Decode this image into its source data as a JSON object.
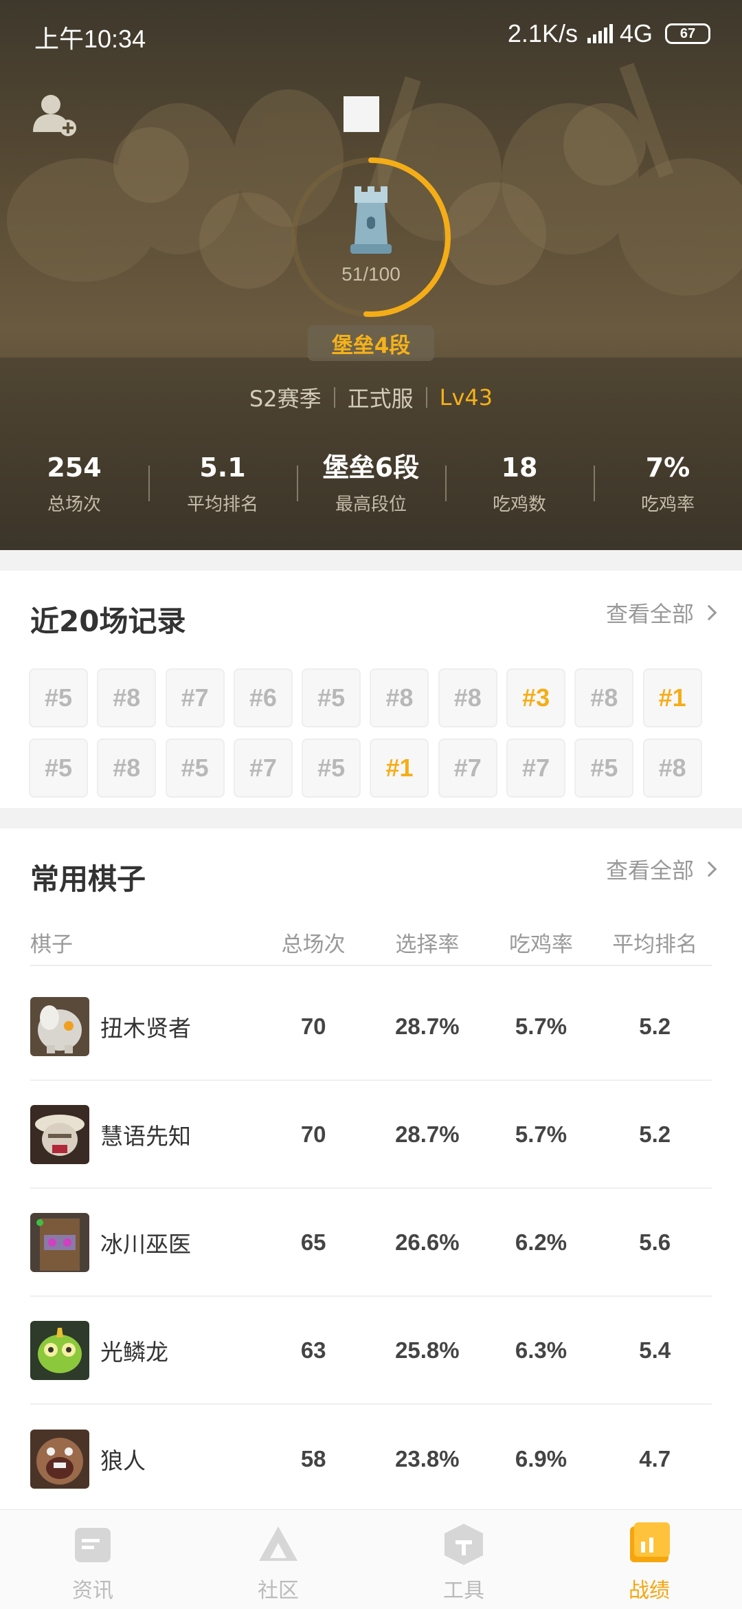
{
  "status_bar": {
    "time": "上午10:34",
    "speed": "2.1K/s",
    "network": "4G",
    "battery": "67"
  },
  "hero": {
    "rank_progress": "51/100",
    "rank_progress_fraction": 0.51,
    "rank_name": "堡垒4段",
    "season": "S2赛季",
    "server": "正式服",
    "level": "Lv43"
  },
  "stats": [
    {
      "value": "254",
      "label": "总场次"
    },
    {
      "value": "5.1",
      "label": "平均排名"
    },
    {
      "value": "堡垒6段",
      "label": "最高段位"
    },
    {
      "value": "18",
      "label": "吃鸡数"
    },
    {
      "value": "7%",
      "label": "吃鸡率"
    }
  ],
  "records": {
    "title": "近20场记录",
    "view_all": "查看全部",
    "ranks": [
      "#5",
      "#8",
      "#7",
      "#6",
      "#5",
      "#8",
      "#8",
      "#3",
      "#8",
      "#1",
      "#5",
      "#8",
      "#5",
      "#7",
      "#5",
      "#1",
      "#7",
      "#7",
      "#5",
      "#8"
    ],
    "highlight_color": "#f5ad17"
  },
  "pieces": {
    "title": "常用棋子",
    "view_all": "查看全部",
    "headers": {
      "name": "棋子",
      "games": "总场次",
      "pick_rate": "选择率",
      "win_rate": "吃鸡率",
      "avg_rank": "平均排名"
    },
    "rows": [
      {
        "name": "扭木贤者",
        "games": "70",
        "pick_rate": "28.7%",
        "win_rate": "5.7%",
        "avg_rank": "5.2"
      },
      {
        "name": "慧语先知",
        "games": "70",
        "pick_rate": "28.7%",
        "win_rate": "5.7%",
        "avg_rank": "5.2"
      },
      {
        "name": "冰川巫医",
        "games": "65",
        "pick_rate": "26.6%",
        "win_rate": "6.2%",
        "avg_rank": "5.6"
      },
      {
        "name": "光鳞龙",
        "games": "63",
        "pick_rate": "25.8%",
        "win_rate": "6.3%",
        "avg_rank": "5.4"
      },
      {
        "name": "狼人",
        "games": "58",
        "pick_rate": "23.8%",
        "win_rate": "6.9%",
        "avg_rank": "4.7"
      }
    ]
  },
  "tabs": [
    {
      "label": "资讯",
      "icon": "news-icon"
    },
    {
      "label": "社区",
      "icon": "community-icon"
    },
    {
      "label": "工具",
      "icon": "tools-icon"
    },
    {
      "label": "战绩",
      "icon": "stats-icon",
      "active": true
    }
  ],
  "colors": {
    "accent": "#f5a60e",
    "gold": "#f5b21a"
  }
}
